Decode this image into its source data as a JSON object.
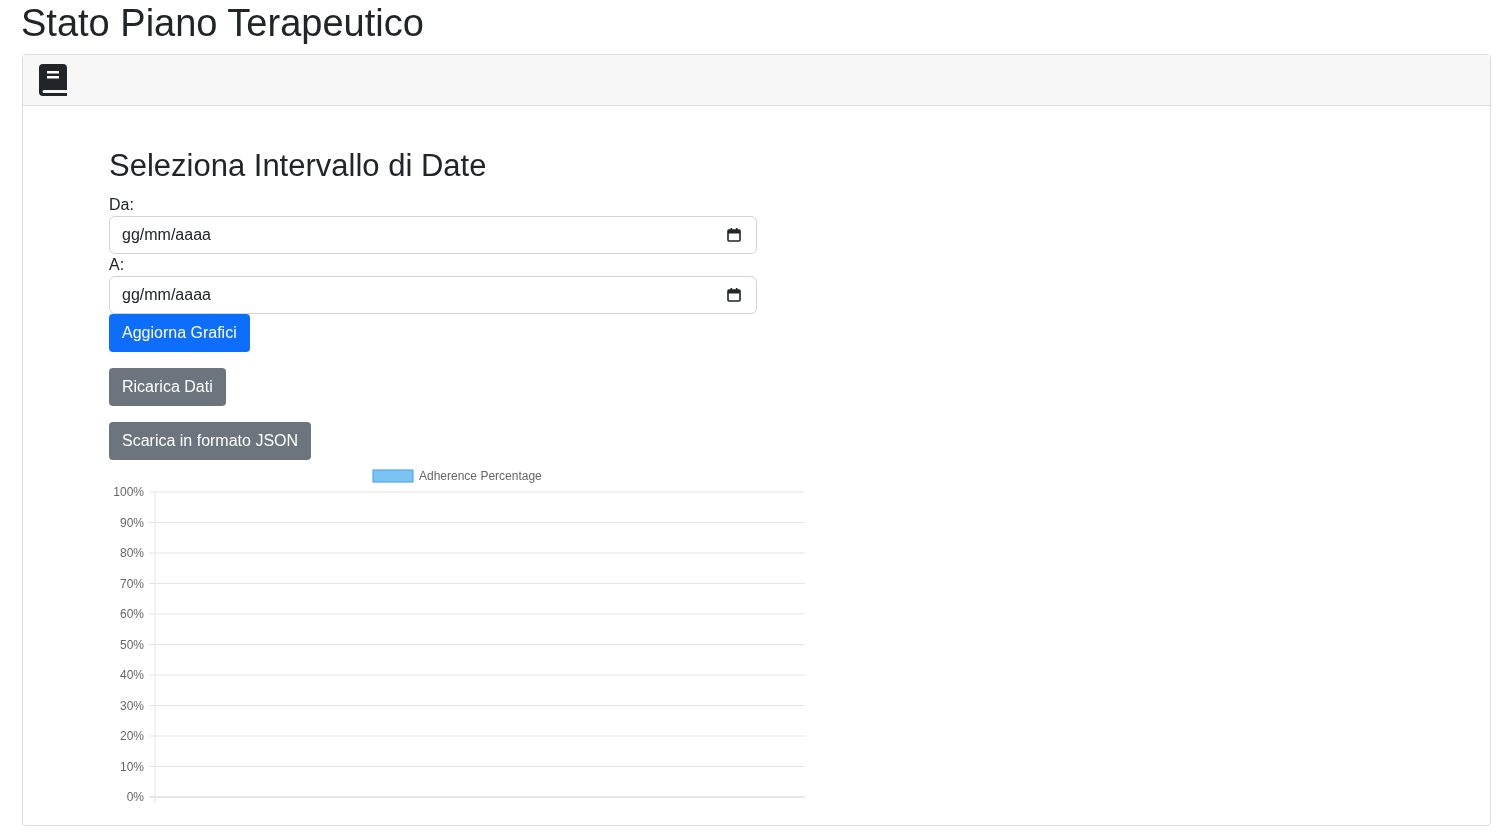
{
  "page_title": "Stato Piano Terapeutico",
  "section_title": "Seleziona Intervallo di Date",
  "fields": [
    {
      "label": "Da:",
      "placeholder": "gg/mm/aaaa"
    },
    {
      "label": "A:",
      "placeholder": "gg/mm/aaaa"
    }
  ],
  "buttons": [
    {
      "label": "Aggiorna Grafici",
      "kind": "primary"
    },
    {
      "label": "Ricarica Dati",
      "kind": "secondary"
    },
    {
      "label": "Scarica in formato JSON",
      "kind": "secondary"
    }
  ],
  "chart_data": {
    "type": "bar",
    "grid": true,
    "series": [
      {
        "name": "Adherence Percentage",
        "color": "#36a2eb"
      }
    ],
    "ylim": [
      0,
      100
    ],
    "yticks": [
      {
        "value": 0,
        "label": "0%"
      },
      {
        "value": 10,
        "label": "10%"
      },
      {
        "value": 20,
        "label": "20%"
      },
      {
        "value": 30,
        "label": "30%"
      },
      {
        "value": 40,
        "label": "40%"
      },
      {
        "value": 50,
        "label": "50%"
      },
      {
        "value": 60,
        "label": "60%"
      },
      {
        "value": 70,
        "label": "70%"
      },
      {
        "value": 80,
        "label": "80%"
      },
      {
        "value": 90,
        "label": "90%"
      },
      {
        "value": 100,
        "label": "100%"
      }
    ]
  }
}
